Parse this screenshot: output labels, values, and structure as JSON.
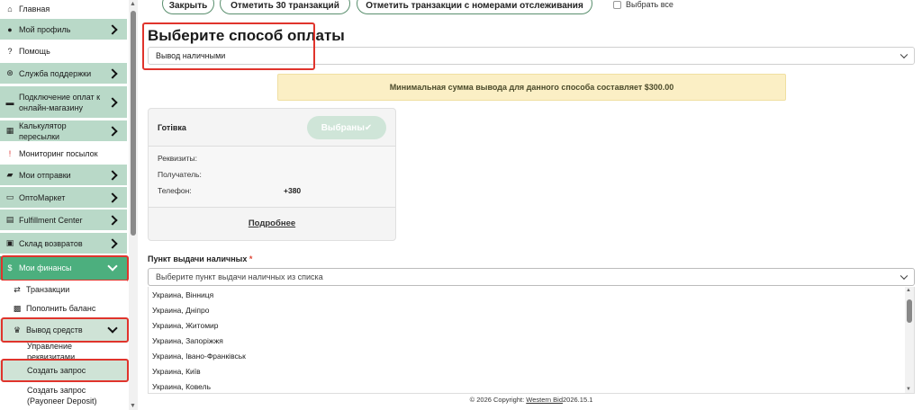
{
  "sidebar": {
    "items": [
      {
        "label": "Главная",
        "icon": "home-icon",
        "glyph": "⌂"
      },
      {
        "label": "Мой профиль",
        "icon": "user-icon",
        "glyph": "●"
      },
      {
        "label": "Помощь",
        "icon": "question-icon",
        "glyph": "?"
      },
      {
        "label": "Служба поддержки",
        "icon": "support-icon",
        "glyph": "⊛"
      },
      {
        "label": "Подключение оплат к онлайн-магазину",
        "icon": "cart-icon",
        "glyph": "▬"
      },
      {
        "label": "Калькулятор пересылки",
        "icon": "calculator-icon",
        "glyph": "▦"
      },
      {
        "label": "Мониторинг посылок",
        "icon": "alert-icon",
        "glyph": "!"
      },
      {
        "label": "Мои отправки",
        "icon": "truck-icon",
        "glyph": "▰"
      },
      {
        "label": "ОптоМаркет",
        "icon": "store-icon",
        "glyph": "▭"
      },
      {
        "label": "Fulfillment Center",
        "icon": "warehouse-icon",
        "glyph": "▤"
      },
      {
        "label": "Склад возвратов",
        "icon": "box-icon",
        "glyph": "▣"
      },
      {
        "label": "Мои финансы",
        "icon": "dollar-icon",
        "glyph": "$"
      },
      {
        "label": "Транзакции",
        "icon": "transfer-icon",
        "glyph": "⇄"
      },
      {
        "label": "Пополнить баланс",
        "icon": "money-icon",
        "glyph": "▩"
      },
      {
        "label": "Вывод средств",
        "icon": "trophy-icon",
        "glyph": "♛"
      },
      {
        "label": "Управление реквизитами"
      },
      {
        "label": "Создать запрос"
      },
      {
        "label": "Создать запрос (Payoneer Deposit)"
      }
    ]
  },
  "toolbar": {
    "close_label": "Закрыть",
    "mark30_label": "Отметить 30 транзакций",
    "mark_tracking_label": "Отметить транзакции с номерами отслеживания",
    "select_all_label": "Выбрать все"
  },
  "payment": {
    "title": "Выберите способ оплаты",
    "method_value": "Вывод наличными",
    "notice": "Минимальная сумма вывода для данного способа составляет $300.00"
  },
  "card": {
    "name": "Готівка",
    "selected_label": "Выбраны✔",
    "requisites_label": "Реквизиты:",
    "recipients_label": "Получатель:",
    "phone_label": "Телефон:",
    "phone_value": "+380",
    "more_label": "Подробнее"
  },
  "pickup": {
    "label": "Пункт выдачи наличных",
    "required_mark": "*",
    "placeholder": "Выберите пункт выдачи наличных из списка",
    "options": [
      "Украина, Вінниця",
      "Украина, Дніпро",
      "Украина, Житомир",
      "Украина, Запоріжжя",
      "Украина, Івано-Франківськ",
      "Украина, Київ",
      "Украина, Ковель"
    ]
  },
  "footer": {
    "prefix": "© 2026 Copyright:",
    "link": "Western Bid",
    "version": "2026.15.1"
  }
}
